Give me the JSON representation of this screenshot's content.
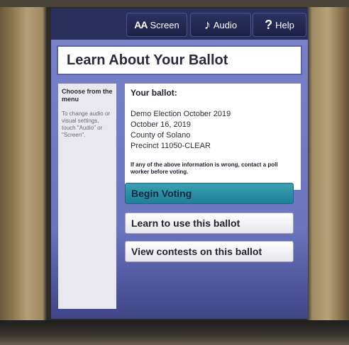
{
  "toolbar": {
    "screen_icon": "AA",
    "screen_label": "Screen",
    "audio_icon": "♪",
    "audio_label": "Audio",
    "help_icon": "?",
    "help_label": "Help"
  },
  "page": {
    "title": "Learn About Your Ballot"
  },
  "sidebar": {
    "heading": "Choose from the menu",
    "hint": "To change audio or visual settings, touch \"Audio\" or \"Screen\"."
  },
  "ballot_info": {
    "label": "Your ballot:",
    "election_name": "Demo Election October 2019",
    "election_date": "October 16, 2019",
    "county": "County of Solano",
    "precinct": "Precinct 11050-CLEAR",
    "warning": "If any of the above information is wrong, contact a poll worker before voting."
  },
  "actions": {
    "begin_voting": "Begin Voting",
    "learn_ballot": "Learn to use this ballot",
    "view_contests": "View contests on this ballot"
  },
  "colors": {
    "screen_background": "#7883c9",
    "header_background": "#2a2f5c",
    "begin_button": "#2a93a8"
  }
}
